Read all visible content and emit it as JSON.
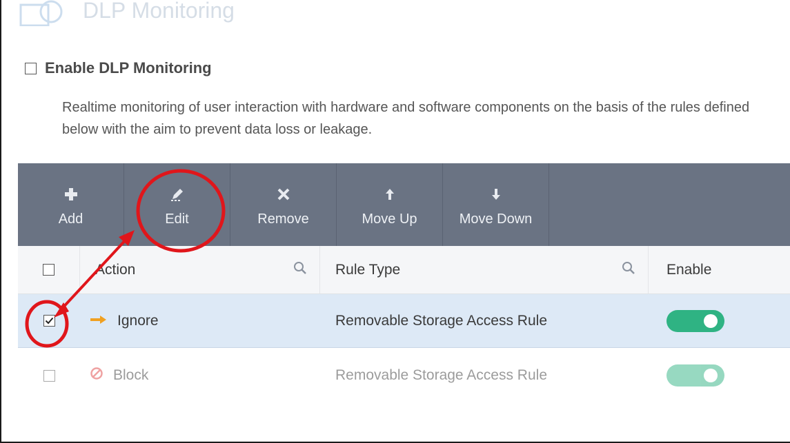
{
  "section": {
    "title": "DLP Monitoring"
  },
  "enable": {
    "label": "Enable DLP Monitoring",
    "checked": false
  },
  "description": "Realtime monitoring of user interaction with hardware and software components on the basis of the rules defined below with the aim to prevent data loss or leakage.",
  "toolbar": {
    "buttons": [
      {
        "label": "Add",
        "icon": "plus-icon"
      },
      {
        "label": "Edit",
        "icon": "pencil-icon"
      },
      {
        "label": "Remove",
        "icon": "x-icon"
      },
      {
        "label": "Move Up",
        "icon": "arrow-up-icon"
      },
      {
        "label": "Move Down",
        "icon": "arrow-down-icon"
      }
    ]
  },
  "table": {
    "headers": {
      "action": "Action",
      "rule_type": "Rule Type",
      "enable": "Enable"
    },
    "rows": [
      {
        "action": "Ignore",
        "action_icon": "arrow-right-icon",
        "rule_type": "Removable Storage Access Rule",
        "enabled": true,
        "selected": true
      },
      {
        "action": "Block",
        "action_icon": "block-icon",
        "rule_type": "Removable Storage Access Rule",
        "enabled": true,
        "selected": false
      }
    ]
  },
  "colors": {
    "toolbar": "#6a7383",
    "toggle_on": "#2fb383",
    "selected_row": "#dde9f6",
    "annotation": "#e0161b",
    "ignore_arrow": "#f0a020",
    "block_icon": "#e04848"
  }
}
